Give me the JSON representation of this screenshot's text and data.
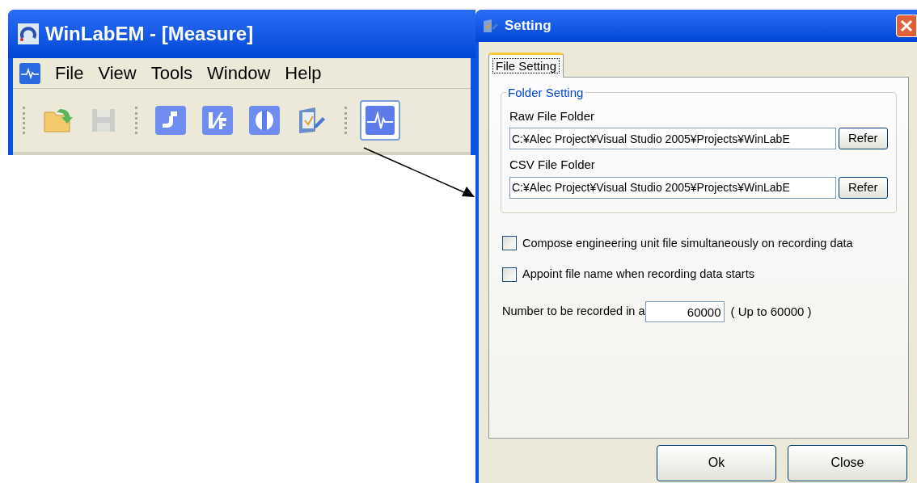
{
  "main_window": {
    "title": "WinLabEM - [Measure]",
    "menu": [
      "File",
      "View",
      "Tools",
      "Window",
      "Help"
    ],
    "toolbar": [
      [
        {
          "disabled": false,
          "selected": false
        },
        {
          "disabled": true,
          "selected": false
        }
      ],
      [
        {
          "disabled": false,
          "selected": false
        },
        {
          "disabled": false,
          "selected": false
        },
        {
          "disabled": false,
          "selected": false
        },
        {
          "disabled": false,
          "selected": false
        }
      ],
      [
        {
          "disabled": false,
          "selected": true
        }
      ]
    ]
  },
  "dialog": {
    "title": "Setting",
    "tabs": [
      {
        "label": "File Setting",
        "selected": true
      }
    ],
    "group": {
      "title": "Folder Setting",
      "folders": [
        {
          "label": "Raw File Folder",
          "value": "C:¥Alec Project¥Visual Studio 2005¥Projects¥WinLabE",
          "button": "Refer"
        },
        {
          "label": "CSV File Folder",
          "value": "C:¥Alec Project¥Visual Studio 2005¥Projects¥WinLabE",
          "button": "Refer"
        }
      ]
    },
    "checkboxes": [
      {
        "label": "Compose engineering unit file simultaneously on recording data",
        "checked": false
      },
      {
        "label": "Appoint file name when recording data starts",
        "checked": false
      }
    ],
    "number": {
      "label": "Number to be recorded in a",
      "value": "60000",
      "hint": "( Up to 60000 )"
    },
    "buttons": [
      "Ok",
      "Close"
    ]
  }
}
